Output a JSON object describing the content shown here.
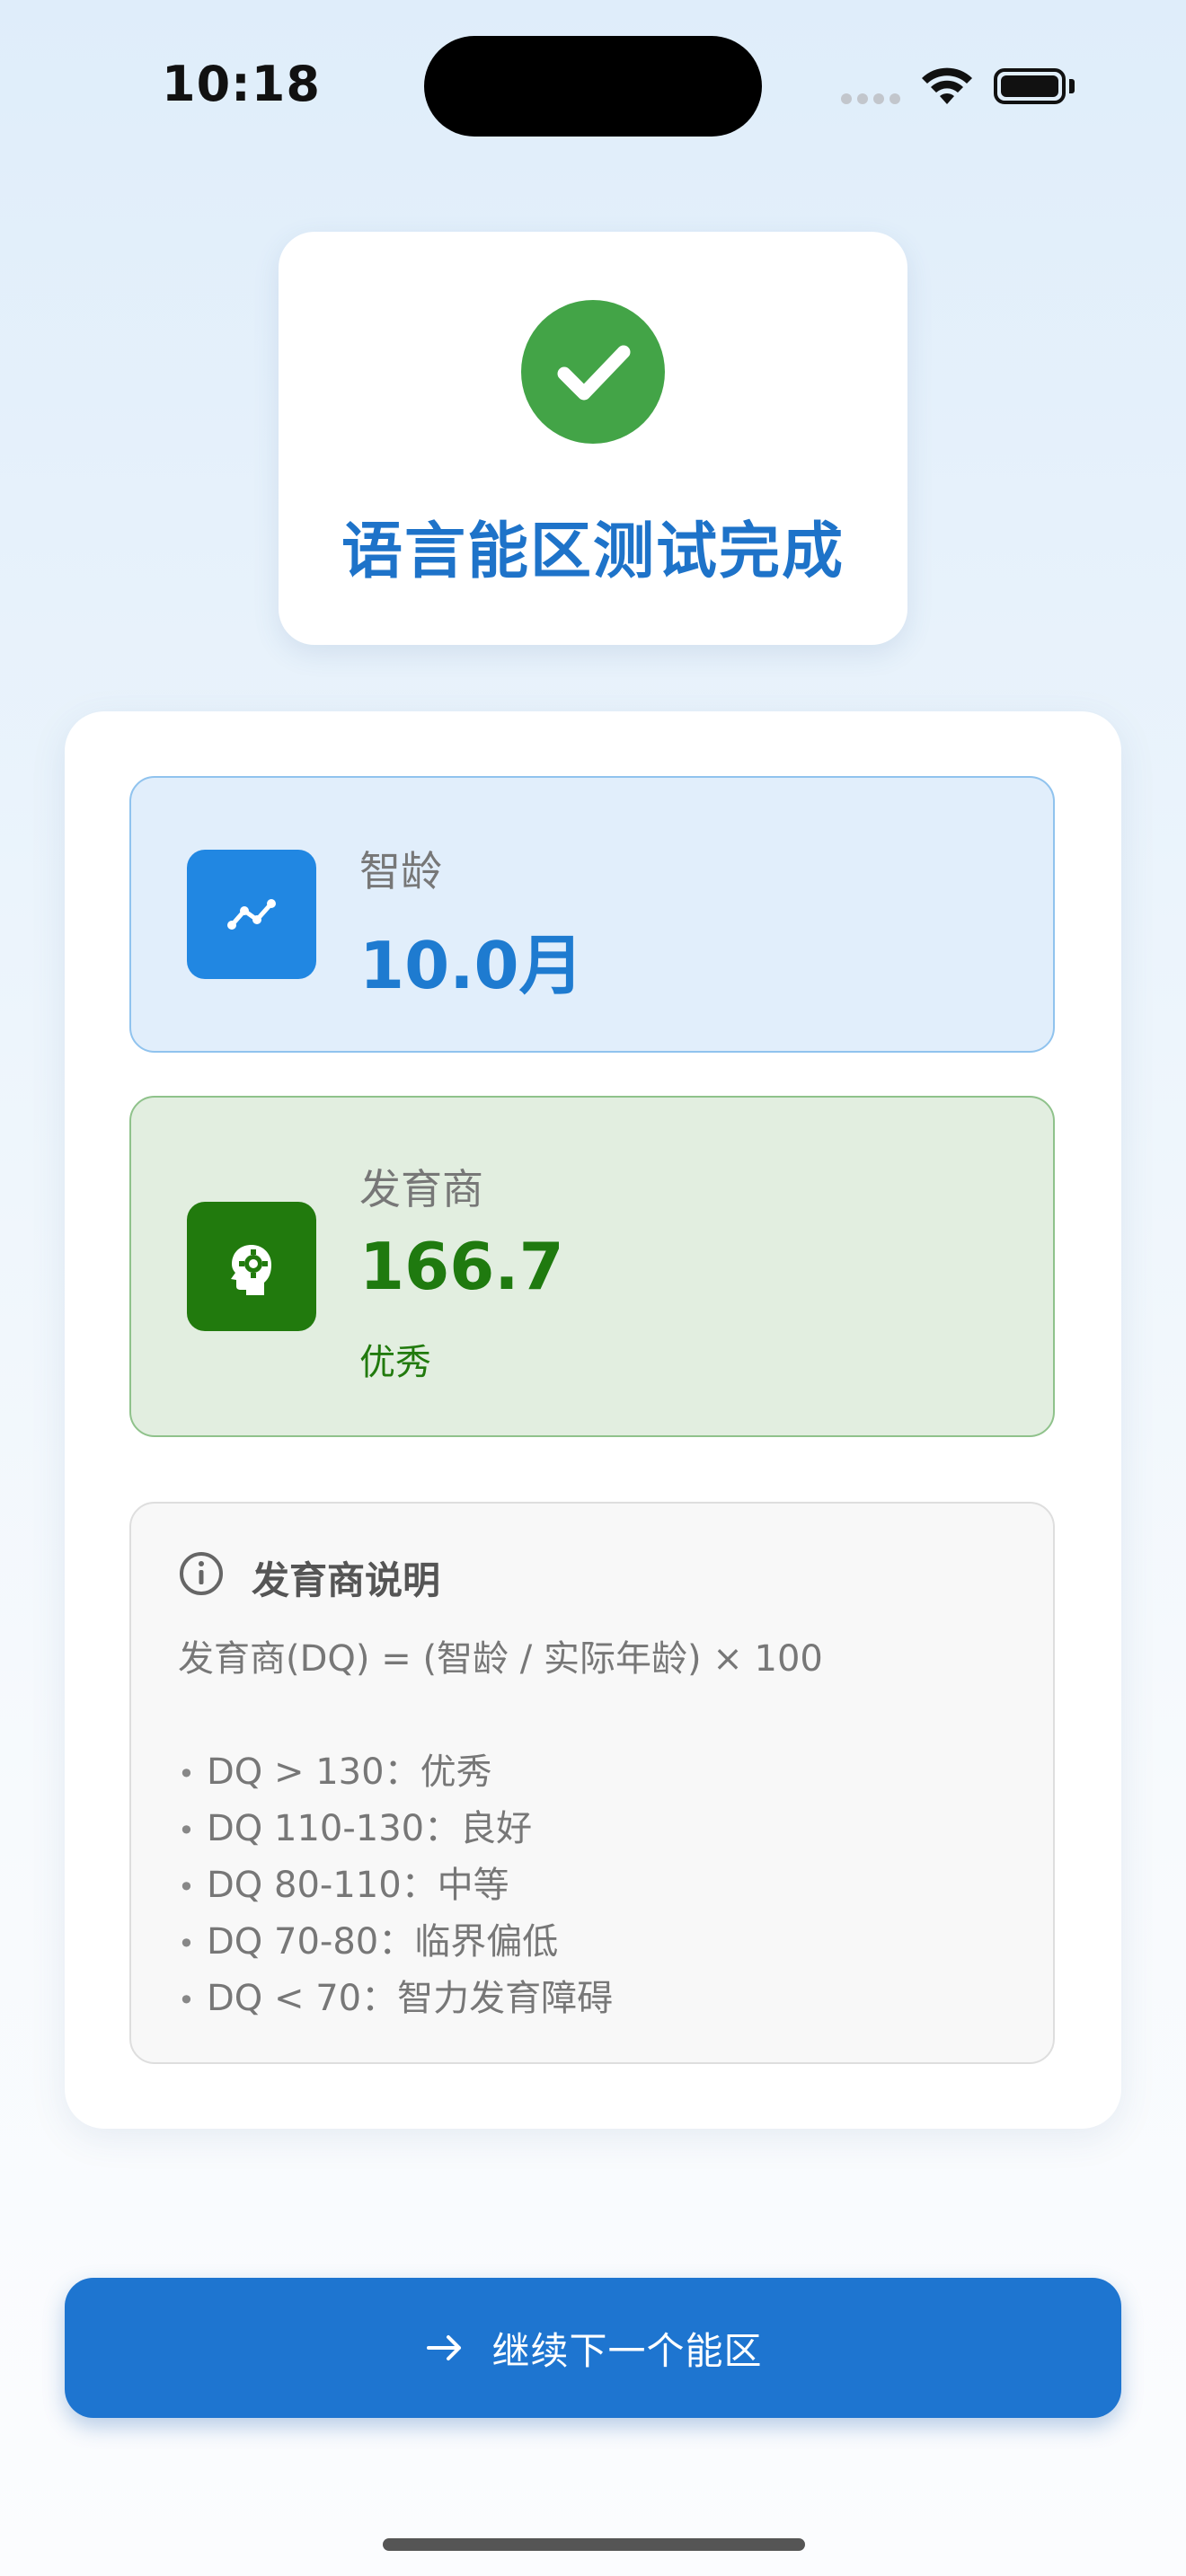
{
  "status_bar": {
    "time": "10:18"
  },
  "header": {
    "title": "语言能区测试完成",
    "icon": "check-circle-icon",
    "icon_color": "#43a447"
  },
  "mental_age": {
    "label": "智龄",
    "value": "10.0月",
    "icon": "trend-line-icon",
    "accent": "#1e7bd0"
  },
  "dq": {
    "label": "发育商",
    "value": "166.7",
    "level": "优秀",
    "icon": "head-gear-icon",
    "accent": "#217a0d"
  },
  "info": {
    "title": "发育商说明",
    "formula": "发育商(DQ) = (智龄 / 实际年龄) × 100",
    "bullet": "•",
    "ranges": [
      "DQ > 130：优秀",
      "DQ 110-130：良好",
      "DQ 80-110：中等",
      "DQ 70-80：临界偏低",
      "DQ < 70：智力发育障碍"
    ]
  },
  "continue_button": {
    "label": "继续下一个能区",
    "icon": "arrow-right-icon",
    "color": "#1e75d0"
  }
}
